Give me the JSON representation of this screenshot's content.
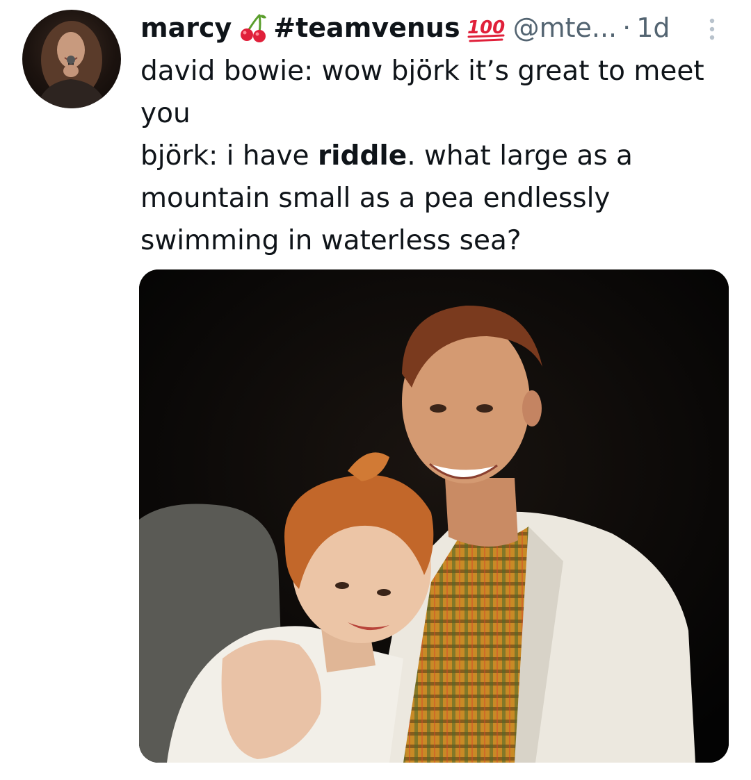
{
  "tweet": {
    "display_name": "marcy",
    "hashtag": "#teamvenus",
    "handle": "@mte...",
    "separator": "·",
    "time": "1d",
    "text": {
      "line1": "david bowie: wow björk it’s great to meet you",
      "line2_prefix": "björk: i have ",
      "line2_bold": "riddle",
      "line2_suffix": ". what large as a mountain small as a pea endlessly swimming in waterless sea?"
    },
    "icons": {
      "cherry": "cherry-emoji",
      "hundred": "hundred-points-emoji",
      "more": "more-vertical-icon"
    }
  },
  "colors": {
    "text": "#0f1419",
    "secondary": "#536471",
    "emoji_red": "#e0203a",
    "emoji_green": "#5a9e2c"
  }
}
